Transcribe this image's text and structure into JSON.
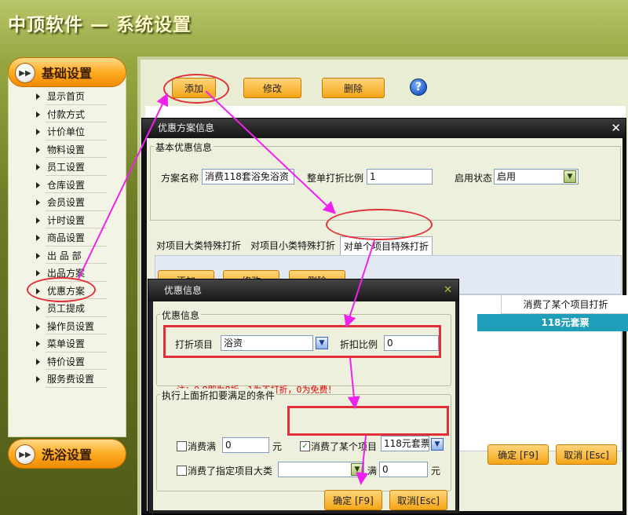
{
  "app": {
    "title_brand": "中顶软件",
    "title_rest": "— 系统设置"
  },
  "sidebar": {
    "basic_header": "基础设置",
    "bath_header": "洗浴设置",
    "items": [
      {
        "label": "显示首页"
      },
      {
        "label": "付款方式"
      },
      {
        "label": "计价单位"
      },
      {
        "label": "物料设置"
      },
      {
        "label": "员工设置"
      },
      {
        "label": "仓库设置"
      },
      {
        "label": "会员设置"
      },
      {
        "label": "计时设置"
      },
      {
        "label": "商品设置"
      },
      {
        "label": "出 品 部"
      },
      {
        "label": "出品方案"
      },
      {
        "label": "优惠方案"
      },
      {
        "label": "员工提成"
      },
      {
        "label": "操作员设置"
      },
      {
        "label": "菜单设置"
      },
      {
        "label": "特价设置"
      },
      {
        "label": "服务费设置"
      }
    ]
  },
  "toolbar": {
    "add": "添加",
    "edit": "修改",
    "delete": "删除",
    "help_icon": "?"
  },
  "dialog1": {
    "title": "优惠方案信息",
    "basic_group": "基本优惠信息",
    "plan_name_label": "方案名称",
    "plan_name_value": "消费118套浴免浴资",
    "discount_label": "整单打折比例",
    "discount_value": "1",
    "status_label": "启用状态",
    "status_value": "启用",
    "tabs": [
      "对项目大类特殊打折",
      "对项目小类特殊打折",
      "对单个项目特殊打折"
    ],
    "inner_add": "添加",
    "inner_edit": "修改",
    "inner_delete": "删除",
    "table_header": "消费了某个项目打折",
    "table_cell": "118元套票",
    "confirm": "确定 [F9]",
    "cancel": "取消 [Esc]"
  },
  "dialog2": {
    "title": "优惠信息",
    "group1": "优惠信息",
    "item_label": "打折项目",
    "item_value": "浴资",
    "ratio_label": "折扣比例",
    "ratio_value": "0",
    "note": "注：0.8即为8折，1为不打折，0为免费！",
    "group2": "执行上面折扣要满足的条件",
    "cond1_label": "消费满",
    "cond1_value": "0",
    "cond1_unit": "元",
    "cond2_label": "消费了某个项目",
    "cond2_value": "118元套票",
    "cond3_label": "消费了指定项目大类",
    "cond3_full": "满",
    "cond3_value": "0",
    "cond3_unit": "元",
    "confirm": "确定 [F9]",
    "cancel": "取消[Esc]"
  },
  "colors": {
    "highlight": "#e0303a",
    "arrow": "#ee22ee",
    "accent_orange": "#f5a516",
    "selection": "#1e9eb8"
  }
}
